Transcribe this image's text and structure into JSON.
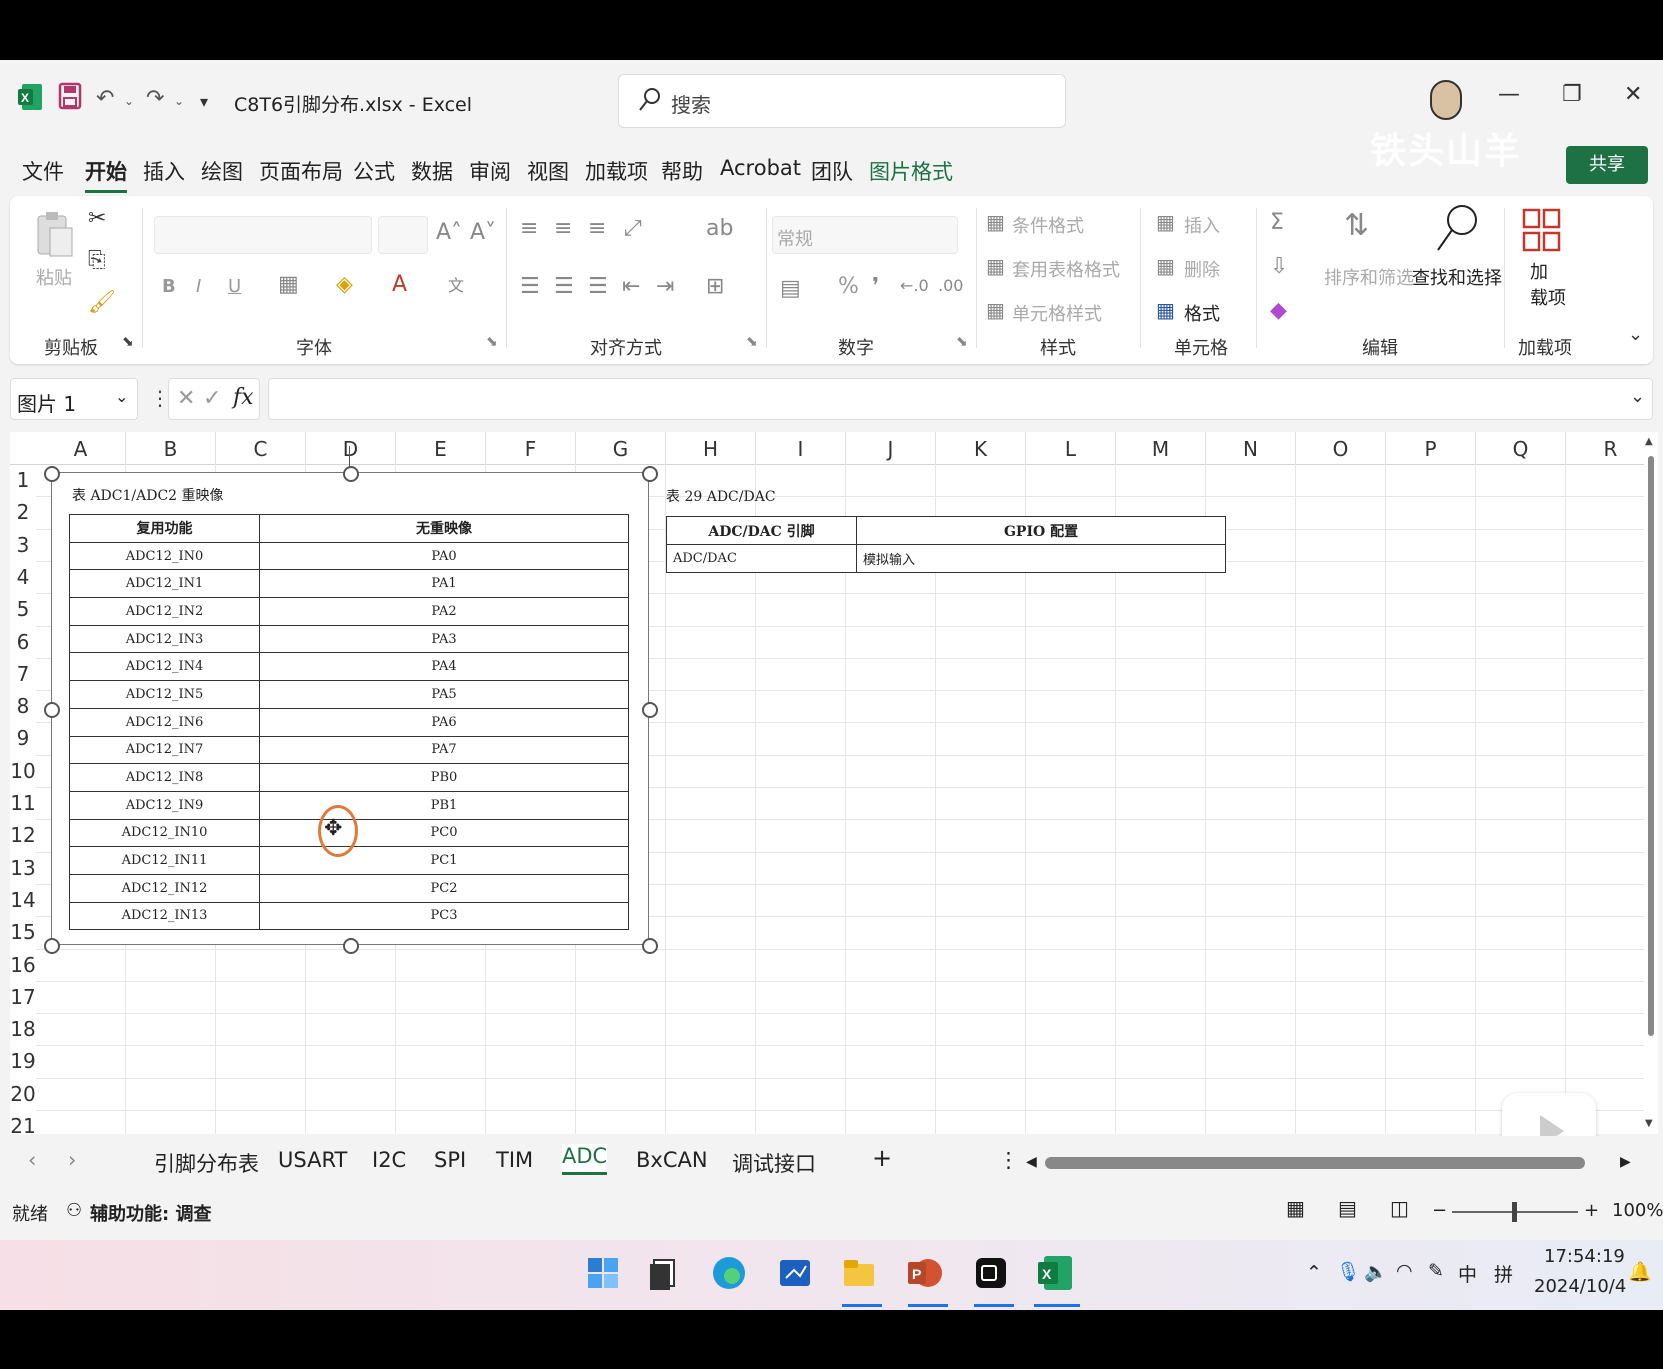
{
  "title_bar": {
    "file_title": "C8T6引脚分布.xlsx  -  Excel",
    "search_placeholder": "搜索"
  },
  "watermark": "铁头山羊",
  "menu": {
    "items": [
      "文件",
      "开始",
      "插入",
      "绘图",
      "页面布局",
      "公式",
      "数据",
      "审阅",
      "视图",
      "加载项",
      "帮助",
      "Acrobat",
      "团队",
      "图片格式"
    ],
    "active": "开始",
    "share_label": "共享"
  },
  "ribbon": {
    "clipboard": {
      "paste": "粘贴",
      "label": "剪贴板"
    },
    "font": {
      "label": "字体",
      "bold": "B",
      "italic": "I",
      "underline": "U"
    },
    "alignment": {
      "label": "对齐方式"
    },
    "number": {
      "format": "常规",
      "label": "数字",
      "percent": "%"
    },
    "styles": {
      "conditional": "条件格式",
      "table": "套用表格格式",
      "cell": "单元格样式",
      "label": "样式"
    },
    "cells": {
      "insert": "插入",
      "delete": "删除",
      "format": "格式",
      "label": "单元格"
    },
    "editing": {
      "sort": "排序和筛选",
      "find": "查找和选择",
      "label": "编辑"
    },
    "addins": {
      "addin": "加\n载项",
      "label": "加载项"
    }
  },
  "formula_bar": {
    "name_box": "图片 1",
    "fx": "fx",
    "content": ""
  },
  "columns": [
    "A",
    "B",
    "C",
    "D",
    "E",
    "F",
    "G",
    "H",
    "I",
    "J",
    "K",
    "L",
    "M",
    "N",
    "O",
    "P",
    "Q",
    "R"
  ],
  "rows": [
    "1",
    "2",
    "3",
    "4",
    "5",
    "6",
    "7",
    "8",
    "9",
    "10",
    "11",
    "12",
    "13",
    "14",
    "15",
    "16",
    "17",
    "18",
    "19",
    "20",
    "21"
  ],
  "picture_table": {
    "title": "表 ADC1/ADC2 重映像",
    "headers": [
      "复用功能",
      "无重映像"
    ],
    "rows": [
      [
        "ADC12_IN0",
        "PA0"
      ],
      [
        "ADC12_IN1",
        "PA1"
      ],
      [
        "ADC12_IN2",
        "PA2"
      ],
      [
        "ADC12_IN3",
        "PA3"
      ],
      [
        "ADC12_IN4",
        "PA4"
      ],
      [
        "ADC12_IN5",
        "PA5"
      ],
      [
        "ADC12_IN6",
        "PA6"
      ],
      [
        "ADC12_IN7",
        "PA7"
      ],
      [
        "ADC12_IN8",
        "PB0"
      ],
      [
        "ADC12_IN9",
        "PB1"
      ],
      [
        "ADC12_IN10",
        "PC0"
      ],
      [
        "ADC12_IN11",
        "PC1"
      ],
      [
        "ADC12_IN12",
        "PC2"
      ],
      [
        "ADC12_IN13",
        "PC3"
      ]
    ]
  },
  "table2": {
    "title": "表 29 ADC/DAC",
    "headers": [
      "ADC/DAC 引脚",
      "GPIO 配置"
    ],
    "rows": [
      [
        "ADC/DAC",
        "模拟输入"
      ]
    ]
  },
  "sheet_tabs": {
    "tabs": [
      "引脚分布表",
      "USART",
      "I2C",
      "SPI",
      "TIM",
      "ADC",
      "BxCAN",
      "调试接口"
    ],
    "active": "ADC",
    "add": "+"
  },
  "status_bar": {
    "ready": "就绪",
    "accessibility": "辅助功能: 调查",
    "zoom": "100%"
  },
  "taskbar": {
    "time": "17:54:19",
    "date": "2024/10/4",
    "ime1": "中",
    "ime2": "拼"
  },
  "colors": {
    "excel_green": "#1e7145",
    "cursor_ring": "#e07a3a"
  }
}
